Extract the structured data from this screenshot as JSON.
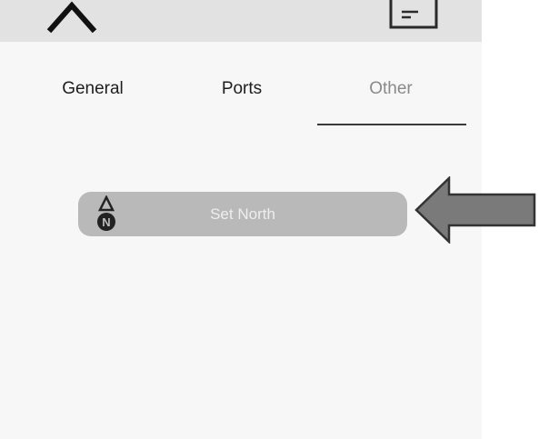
{
  "top_bar": {
    "collapse_icon": "chevron-up-icon",
    "save_icon": "save-icon"
  },
  "tabs": [
    {
      "label": "General",
      "active": false
    },
    {
      "label": "Ports",
      "active": false
    },
    {
      "label": "Other",
      "active": true
    }
  ],
  "other_panel": {
    "set_north_label": "Set North",
    "set_north_icon": "north-compass-icon",
    "compass_letter": "N"
  },
  "annotation": {
    "arrow_icon": "left-pointing-arrow-icon"
  },
  "colors": {
    "top_bar": "#e2e2e2",
    "panel_background": "#f7f7f7",
    "button_background": "#b9b9b9",
    "button_text": "#eeeeee",
    "inactive_tab_text": "#1e1e1e",
    "active_tab_text": "#8a8a8a",
    "indicator": "#3a3a3a",
    "arrow_fill": "#7a7a7a"
  }
}
